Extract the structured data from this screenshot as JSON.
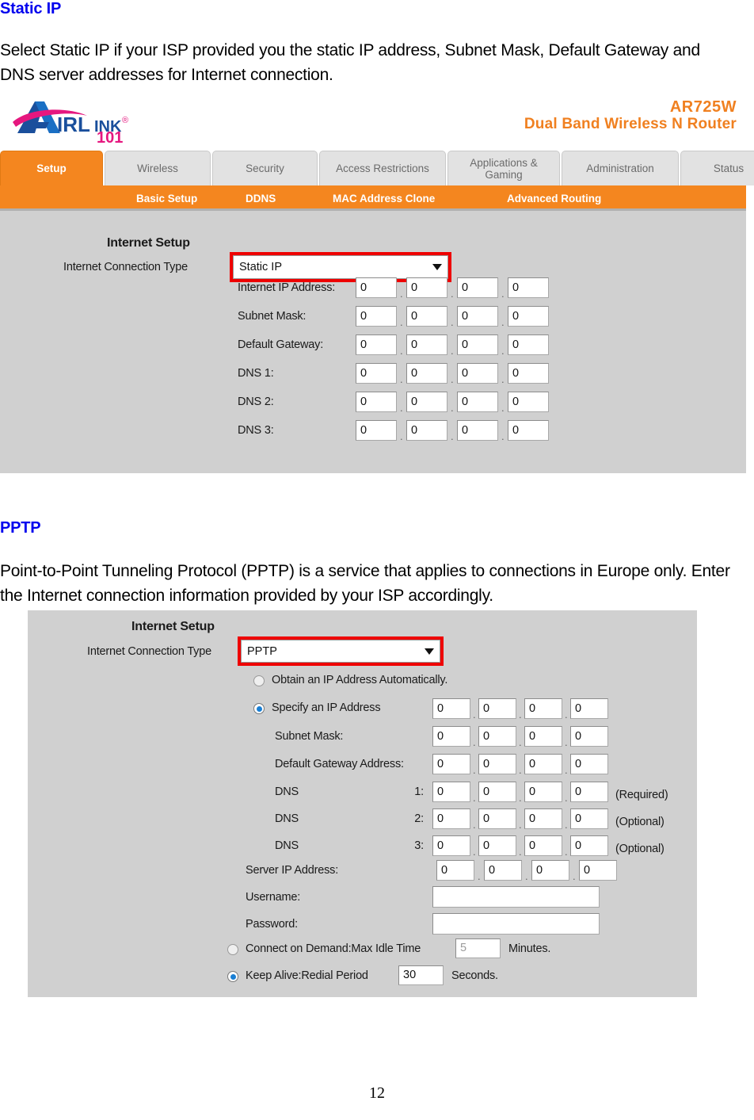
{
  "document": {
    "section1_heading": "Static IP",
    "section1_body": "Select Static IP if your ISP provided you the static IP address, Subnet Mask, Default Gateway and DNS server addresses for Internet connection.",
    "section2_heading": "PPTP",
    "section2_body": "Point-to-Point Tunneling Protocol (PPTP) is a service that applies to connections in Europe only. Enter the Internet connection information provided by your ISP accordingly.",
    "page_number": "12"
  },
  "router": {
    "brand": "AirLink 101",
    "model_name": "AR725W",
    "model_desc": "Dual Band Wireless N Router",
    "accent_color": "#f4861f",
    "highlight_color": "#ee0000",
    "tabs": [
      {
        "label": "Setup",
        "active": true
      },
      {
        "label": "Wireless",
        "active": false
      },
      {
        "label": "Security",
        "active": false
      },
      {
        "label": "Access Restrictions",
        "active": false
      },
      {
        "label": "Applications & Gaming",
        "active": false
      },
      {
        "label": "Administration",
        "active": false
      },
      {
        "label": "Status",
        "active": false
      }
    ],
    "subnav": [
      "Basic Setup",
      "DDNS",
      "MAC Address Clone",
      "Advanced Routing"
    ]
  },
  "static_ip_panel": {
    "section_title": "Internet Setup",
    "connection_type_label": "Internet Connection Type",
    "connection_type_value": "Static IP",
    "rows": [
      {
        "label": "Internet IP Address:",
        "octets": [
          "0",
          "0",
          "0",
          "0"
        ]
      },
      {
        "label": "Subnet Mask:",
        "octets": [
          "0",
          "0",
          "0",
          "0"
        ]
      },
      {
        "label": "Default Gateway:",
        "octets": [
          "0",
          "0",
          "0",
          "0"
        ]
      },
      {
        "label": "DNS 1:",
        "octets": [
          "0",
          "0",
          "0",
          "0"
        ]
      },
      {
        "label": "DNS 2:",
        "octets": [
          "0",
          "0",
          "0",
          "0"
        ]
      },
      {
        "label": "DNS 3:",
        "octets": [
          "0",
          "0",
          "0",
          "0"
        ]
      }
    ]
  },
  "pptp_panel": {
    "section_title": "Internet Setup",
    "connection_type_label": "Internet Connection Type",
    "connection_type_value": "PPTP",
    "obtain_auto_label": "Obtain an IP Address Automatically.",
    "obtain_auto_selected": false,
    "specify_ip_label": "Specify an IP Address",
    "specify_ip_selected": true,
    "specify_octets": [
      "0",
      "0",
      "0",
      "0"
    ],
    "subnet_label": "Subnet Mask:",
    "subnet_octets": [
      "0",
      "0",
      "0",
      "0"
    ],
    "gateway_label": "Default Gateway Address:",
    "gateway_octets": [
      "0",
      "0",
      "0",
      "0"
    ],
    "dns_label": "DNS",
    "dns_rows": [
      {
        "index": "1:",
        "octets": [
          "0",
          "0",
          "0",
          "0"
        ],
        "note": "(Required)"
      },
      {
        "index": "2:",
        "octets": [
          "0",
          "0",
          "0",
          "0"
        ],
        "note": "(Optional)"
      },
      {
        "index": "3:",
        "octets": [
          "0",
          "0",
          "0",
          "0"
        ],
        "note": "(Optional)"
      }
    ],
    "server_ip_label": "Server IP Address:",
    "server_ip_octets": [
      "0",
      "0",
      "0",
      "0"
    ],
    "username_label": "Username:",
    "username_value": "",
    "password_label": "Password:",
    "password_value": "",
    "connect_demand_label": "Connect on Demand:Max Idle Time",
    "connect_demand_value": "5",
    "connect_demand_unit": "Minutes.",
    "connect_demand_selected": false,
    "keep_alive_label": "Keep Alive:Redial Period",
    "keep_alive_value": "30",
    "keep_alive_unit": "Seconds.",
    "keep_alive_selected": true
  }
}
